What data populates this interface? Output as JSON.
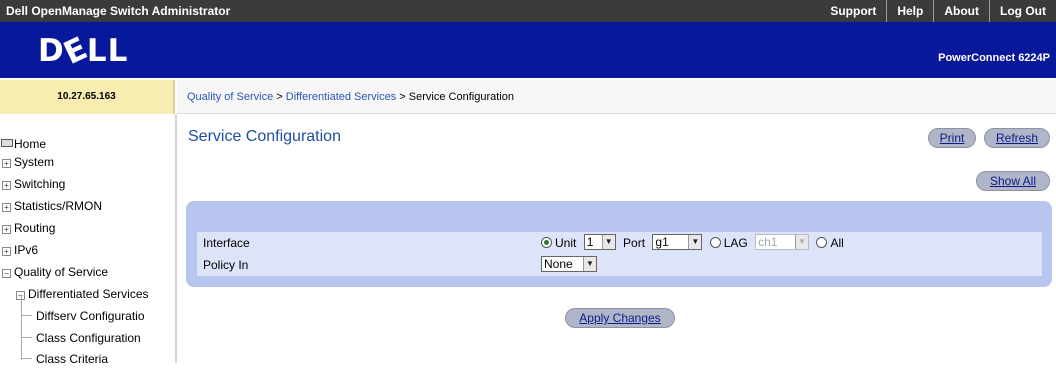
{
  "app": {
    "title": "Dell OpenManage Switch Administrator"
  },
  "header_links": [
    "Support",
    "Help",
    "About",
    "Log Out"
  ],
  "brand": {
    "logo": "D&LL",
    "model": "PowerConnect 6224P"
  },
  "ip_address": "10.27.65.163",
  "breadcrumb": {
    "part1": "Quality of Service",
    "sep1": ">",
    "part2": "Differentiated Services",
    "sep2": ">",
    "part3": "Service Configuration"
  },
  "sidebar": {
    "items": [
      {
        "label": "Home"
      },
      {
        "label": "System"
      },
      {
        "label": "Switching"
      },
      {
        "label": "Statistics/RMON"
      },
      {
        "label": "Routing"
      },
      {
        "label": "IPv6"
      },
      {
        "label": "Quality of Service"
      },
      {
        "label": "Differentiated Services"
      },
      {
        "label": "Diffserv Configuratio"
      },
      {
        "label": "Class Configuration"
      },
      {
        "label": "Class Criteria"
      }
    ]
  },
  "page": {
    "title": "Service Configuration",
    "print_label": "Print",
    "refresh_label": "Refresh",
    "show_all_label": "Show All"
  },
  "form": {
    "interface_label": "Interface",
    "unit_label": "Unit",
    "unit_value": "1",
    "port_label": "Port",
    "port_value": "g1",
    "lag_label": "LAG",
    "lag_value": "ch1",
    "all_label": "All",
    "policy_label": "Policy In",
    "policy_value": "None"
  },
  "apply_label": "Apply Changes"
}
